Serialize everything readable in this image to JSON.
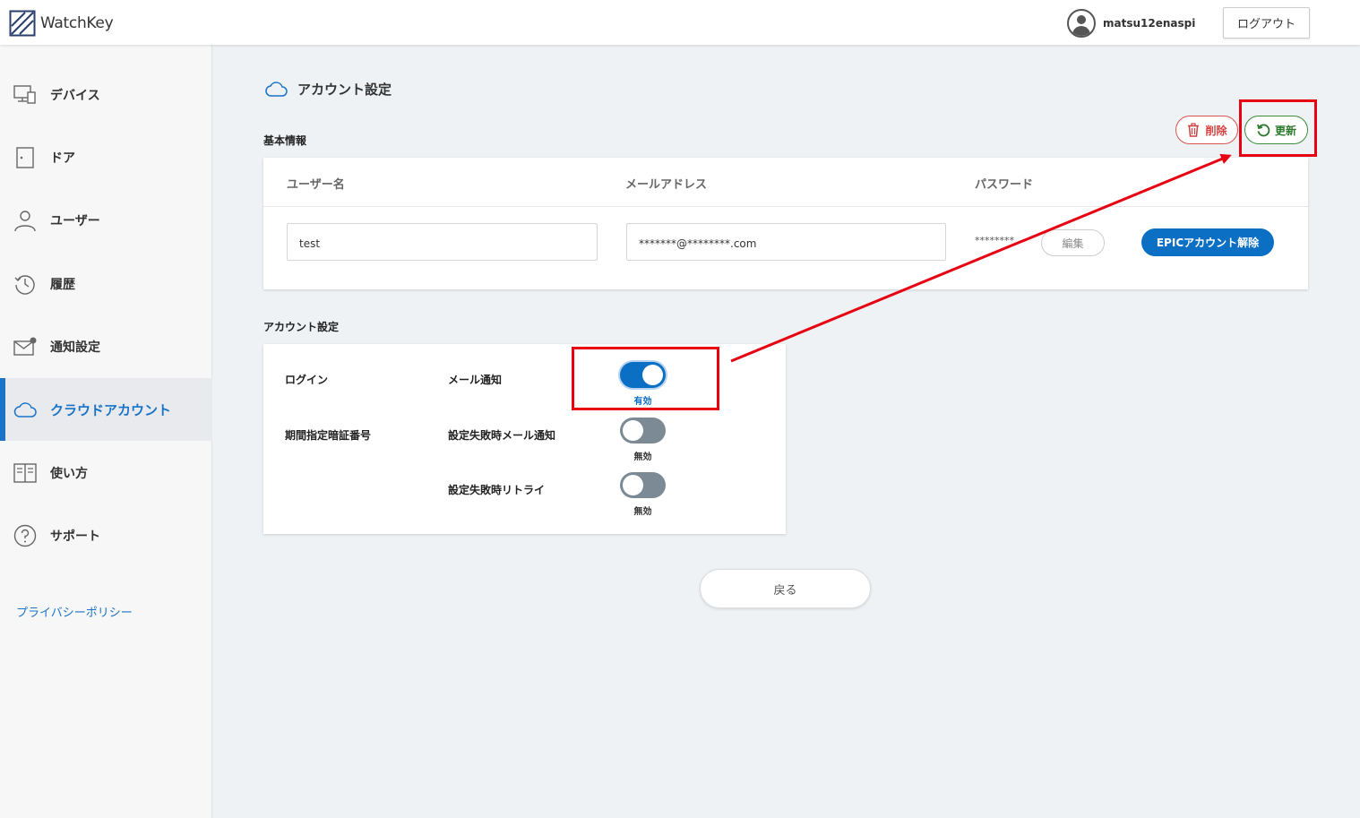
{
  "header": {
    "logo_text": "WatchKey",
    "username": "matsu12enaspi",
    "logout_label": "ログアウト"
  },
  "sidebar": {
    "items": [
      {
        "label": "デバイス",
        "icon": "device-icon"
      },
      {
        "label": "ドア",
        "icon": "door-icon"
      },
      {
        "label": "ユーザー",
        "icon": "user-icon"
      },
      {
        "label": "履歴",
        "icon": "history-icon"
      },
      {
        "label": "通知設定",
        "icon": "mail-icon"
      },
      {
        "label": "クラウドアカウント",
        "icon": "cloud-icon",
        "active": true
      },
      {
        "label": "使い方",
        "icon": "book-icon"
      },
      {
        "label": "サポート",
        "icon": "help-icon"
      }
    ],
    "privacy_label": "プライバシーポリシー"
  },
  "main": {
    "title": "アカウント設定",
    "basic_info": {
      "section_label": "基本情報",
      "delete_label": "削除",
      "update_label": "更新",
      "columns": [
        "ユーザー名",
        "メールアドレス",
        "パスワード"
      ],
      "username_value": "test",
      "email_value": "*******@********.com",
      "password_mask": "********",
      "edit_label": "編集",
      "epic_label": "EPICアカウント解除"
    },
    "account_settings": {
      "section_label": "アカウント設定",
      "login_label": "ログイン",
      "period_pin_label": "期間指定暗証番号",
      "toggles": [
        {
          "label": "メール通知",
          "state": "有効",
          "on": true
        },
        {
          "label": "設定失敗時メール通知",
          "state": "無効",
          "on": false
        },
        {
          "label": "設定失敗時リトライ",
          "state": "無効",
          "on": false
        }
      ]
    },
    "back_label": "戻る"
  },
  "colors": {
    "accent": "#0b6fc4",
    "annotation": "#e60012",
    "delete": "#d04040",
    "update": "#2d7a2d"
  }
}
